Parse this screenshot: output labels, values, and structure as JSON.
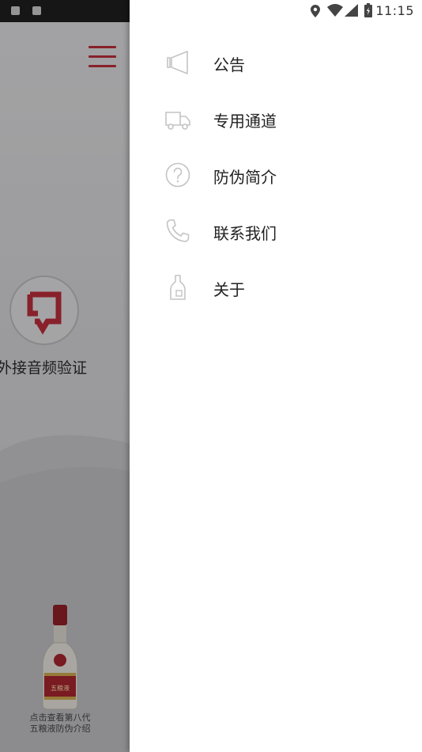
{
  "status_bar": {
    "time": "11:15"
  },
  "background_app": {
    "verify_label": "外接音频验证",
    "bottle_caption_line1": "点击查看第八代",
    "bottle_caption_line2": "五粮液防伪介绍",
    "bottle_label_text": "五粮液"
  },
  "drawer": {
    "items": [
      {
        "label": "公告",
        "icon": "megaphone-icon"
      },
      {
        "label": "专用通道",
        "icon": "truck-icon"
      },
      {
        "label": "防伪简介",
        "icon": "help-circle-icon"
      },
      {
        "label": "联系我们",
        "icon": "phone-icon"
      },
      {
        "label": "关于",
        "icon": "bottle-icon"
      }
    ]
  },
  "colors": {
    "accent": "#b82d3b",
    "icon_gray": "#c4c4c4",
    "text": "#222222"
  }
}
